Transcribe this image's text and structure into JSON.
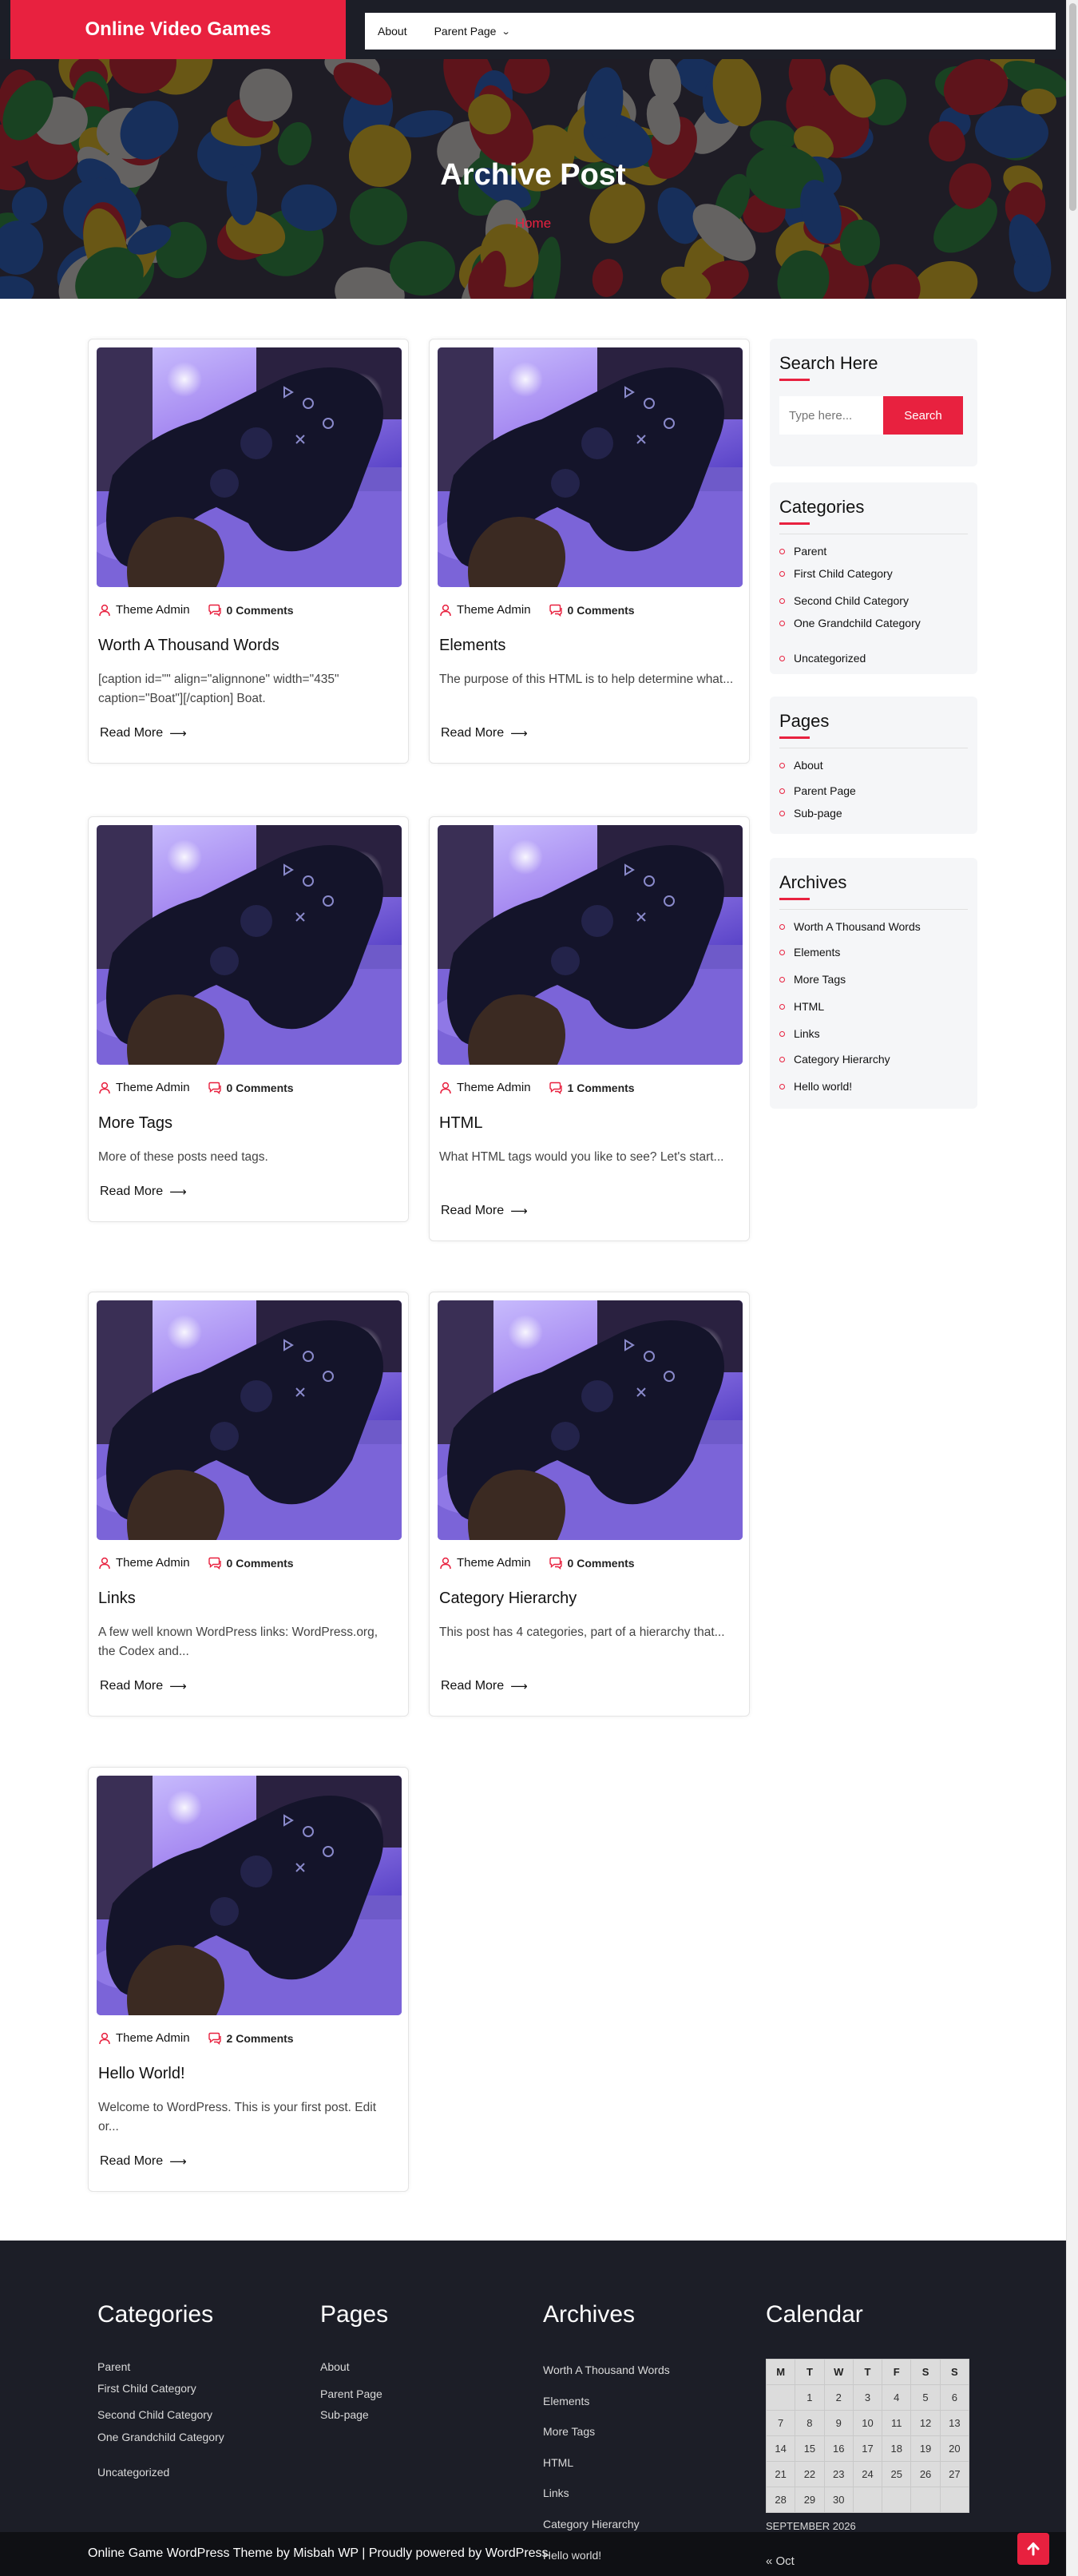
{
  "site": {
    "title": "Online Video Games"
  },
  "nav": {
    "items": [
      {
        "label": "About"
      },
      {
        "label": "Parent Page"
      }
    ]
  },
  "hero": {
    "title": "Archive Post",
    "breadcrumb": "Home"
  },
  "posts": [
    {
      "author": "Theme Admin",
      "comments": "0 Comments",
      "title": "Worth A Thousand Words",
      "excerpt": "[caption id=\"\" align=\"alignnone\" width=\"435\" caption=\"Boat\"][/caption] Boat.",
      "read_more": "Read More"
    },
    {
      "author": "Theme Admin",
      "comments": "0 Comments",
      "title": "Elements",
      "excerpt": "The purpose of this HTML is to help determine what...",
      "read_more": "Read More"
    },
    {
      "author": "Theme Admin",
      "comments": "0 Comments",
      "title": "More Tags",
      "excerpt": "More of these posts need tags.",
      "read_more": "Read More"
    },
    {
      "author": "Theme Admin",
      "comments": "1 Comments",
      "title": "HTML",
      "excerpt": "What HTML tags would you like to see? Let's start...",
      "read_more": "Read More"
    },
    {
      "author": "Theme Admin",
      "comments": "0 Comments",
      "title": "Links",
      "excerpt": "A few well known WordPress links: WordPress.org, the Codex and...",
      "read_more": "Read More"
    },
    {
      "author": "Theme Admin",
      "comments": "0 Comments",
      "title": "Category Hierarchy",
      "excerpt": "This post has 4 categories, part of a hierarchy that...",
      "read_more": "Read More"
    },
    {
      "author": "Theme Admin",
      "comments": "2 Comments",
      "title": "Hello World!",
      "excerpt": "Welcome to WordPress. This is your first post. Edit or...",
      "read_more": "Read More"
    }
  ],
  "sidebar": {
    "search": {
      "title": "Search Here",
      "placeholder": "Type here...",
      "button": "Search"
    },
    "categories": {
      "title": "Categories",
      "items": [
        "Parent",
        "First Child Category",
        "Second Child Category",
        "One Grandchild Category",
        "Uncategorized"
      ]
    },
    "pages": {
      "title": "Pages",
      "items": [
        "About",
        "Parent Page",
        "Sub-page"
      ]
    },
    "archives": {
      "title": "Archives",
      "items": [
        "Worth A Thousand Words",
        "Elements",
        "More Tags",
        "HTML",
        "Links",
        "Category Hierarchy",
        "Hello world!"
      ]
    }
  },
  "footer": {
    "categories": {
      "title": "Categories",
      "items": [
        "Parent",
        "First Child Category",
        "Second Child Category",
        "One Grandchild Category",
        "Uncategorized"
      ]
    },
    "pages": {
      "title": "Pages",
      "items": [
        "About",
        "Parent Page",
        "Sub-page"
      ]
    },
    "archives": {
      "title": "Archives",
      "items": [
        "Worth A Thousand Words",
        "Elements",
        "More Tags",
        "HTML",
        "Links",
        "Category Hierarchy",
        "Hello world!"
      ]
    },
    "calendar": {
      "title": "Calendar",
      "days": [
        "M",
        "T",
        "W",
        "T",
        "F",
        "S",
        "S"
      ],
      "weeks": [
        [
          "",
          "1",
          "2",
          "3",
          "4",
          "5",
          "6"
        ],
        [
          "7",
          "8",
          "9",
          "10",
          "11",
          "12",
          "13"
        ],
        [
          "14",
          "15",
          "16",
          "17",
          "18",
          "19",
          "20"
        ],
        [
          "21",
          "22",
          "23",
          "24",
          "25",
          "26",
          "27"
        ],
        [
          "28",
          "29",
          "30",
          "",
          "",
          "",
          ""
        ]
      ],
      "caption": "SEPTEMBER 2026",
      "prev": "« Oct"
    },
    "copyright": "Online Game WordPress Theme by Misbah WP | Proudly powered by WordPress"
  },
  "colors": {
    "accent": "#e8213f",
    "dark": "#1c1e27",
    "sidebar_bg": "#f5f6f8"
  },
  "icons": {
    "author": "user-icon",
    "comments": "comment-icon",
    "read_more": "arrow-right-icon",
    "back_to_top": "arrow-up-icon",
    "nav_dropdown": "chevron-down-icon"
  }
}
